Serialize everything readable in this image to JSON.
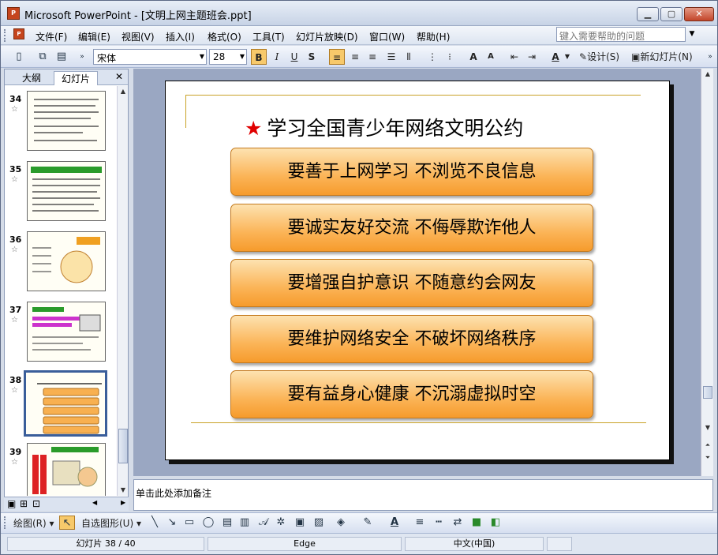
{
  "window": {
    "title": "Microsoft PowerPoint - [文明上网主题班会.ppt]"
  },
  "menu": [
    "文件(F)",
    "编辑(E)",
    "视图(V)",
    "插入(I)",
    "格式(O)",
    "工具(T)",
    "幻灯片放映(D)",
    "窗口(W)",
    "帮助(H)"
  ],
  "help_placeholder": "键入需要帮助的问题",
  "format": {
    "font": "宋体",
    "size": "28",
    "design_label": "设计(S)",
    "new_slide_label": "新幻灯片(N)"
  },
  "panel": {
    "tab_outline": "大纲",
    "tab_slides": "幻灯片"
  },
  "thumbnails": [
    {
      "num": "34"
    },
    {
      "num": "35"
    },
    {
      "num": "36"
    },
    {
      "num": "37"
    },
    {
      "num": "38"
    },
    {
      "num": "39"
    }
  ],
  "slide": {
    "title": "学习全国青少年网络文明公约",
    "items": [
      "要善于上网学习  不浏览不良信息",
      "要诚实友好交流  不侮辱欺诈他人",
      "要增强自护意识  不随意约会网友",
      "要维护网络安全  不破坏网络秩序",
      "要有益身心健康  不沉溺虚拟时空"
    ]
  },
  "notes_placeholder": "单击此处添加备注",
  "drawing": {
    "draw_label": "绘图(R)",
    "autoshapes_label": "自选图形(U)"
  },
  "status": {
    "slide_info": "幻灯片 38 / 40",
    "theme": "Edge",
    "language": "中文(中国)"
  },
  "colors": {
    "accent": "#f69b2c",
    "star": "#e00000",
    "selection": "#3a5e9a"
  }
}
